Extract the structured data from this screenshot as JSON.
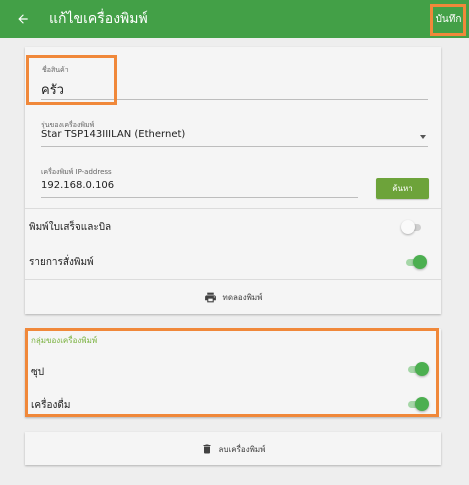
{
  "appbar": {
    "title": "แก้ไขเครื่องพิมพ์",
    "save_label": "บันทึก",
    "back_icon": "arrow-left-icon"
  },
  "form": {
    "product_name": {
      "label": "ชื่อสินค้า",
      "value": "ครัว"
    },
    "printer_model": {
      "label": "รุ่นของเครื่องพิมพ์",
      "value": "Star TSP143IIILAN (Ethernet)"
    },
    "ip_address": {
      "label": "เครื่องพิมพ์ IP-address",
      "value": "192.168.0.106"
    },
    "search_label": "ค้นหา"
  },
  "toggles": [
    {
      "label": "พิมพ์ใบเสร็จและบิล",
      "on": false
    },
    {
      "label": "รายการสั่งพิมพ์",
      "on": true
    }
  ],
  "test_print": {
    "label": "ทดลองพิมพ์",
    "icon": "printer-icon"
  },
  "printer_group": {
    "title": "กลุ่มของเครื่องพิมพ์",
    "items": [
      {
        "label": "ซุป",
        "on": true
      },
      {
        "label": "เครื่องดื่ม",
        "on": true
      }
    ]
  },
  "delete_printer": {
    "label": "ลบเครื่องพิมพ์",
    "icon": "trash-icon"
  },
  "colors": {
    "appbar": "#43a047",
    "accent": "#4caf50",
    "button": "#6da33a",
    "group_title": "#7cb342",
    "highlight": "#f0883a"
  }
}
